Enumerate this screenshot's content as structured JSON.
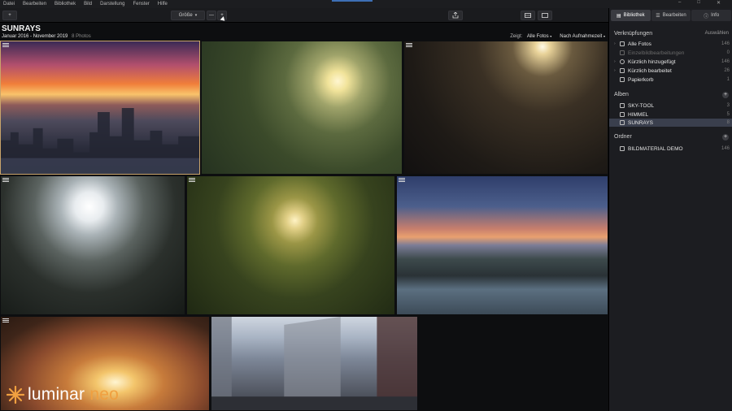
{
  "menu": [
    "Datei",
    "Bearbeiten",
    "Bibliothek",
    "Bild",
    "Darstellung",
    "Fenster",
    "Hilfe"
  ],
  "window_controls": [
    "–",
    "□",
    "✕"
  ],
  "toolbar": {
    "add_label": "+",
    "size_label": "Größe",
    "zoom_out": "—",
    "zoom_in": "+"
  },
  "header": {
    "title": "SUNRAYS",
    "date_range": "Januar 2016 - November 2019",
    "count": "8 Photos",
    "show_label": "Zeigt:",
    "show_value": "Alle Fotos",
    "sort_value": "Nach Aufnahmezeit"
  },
  "sidebar": {
    "tabs": [
      "Bibliothek",
      "Bearbeiten",
      "Info"
    ],
    "links_title": "Verknüpfungen",
    "links_action": "Auswählen",
    "links": [
      {
        "label": "Alle Fotos",
        "count": "146"
      },
      {
        "label": "Einzelbildbearbeitungen",
        "count": "0"
      },
      {
        "label": "Kürzlich hinzugefügt",
        "count": "146"
      },
      {
        "label": "Kürzlich bearbeitet",
        "count": "26"
      },
      {
        "label": "Papierkorb",
        "count": "1"
      }
    ],
    "albums_title": "Alben",
    "albums": [
      {
        "label": "SKY-TOOL",
        "count": "3"
      },
      {
        "label": "HIMMEL",
        "count": "5"
      },
      {
        "label": "SUNRAYS",
        "count": "8"
      }
    ],
    "folders_title": "Ordner",
    "folders": [
      {
        "label": "BILDMATERIAL DEMO",
        "count": "146"
      }
    ]
  },
  "logo": {
    "word1": "luminar",
    "word2": "neo"
  },
  "colors": {
    "accent": "#3d6fb5",
    "logo_orange": "#f0a040",
    "selected_row": "#3a3f4d"
  }
}
